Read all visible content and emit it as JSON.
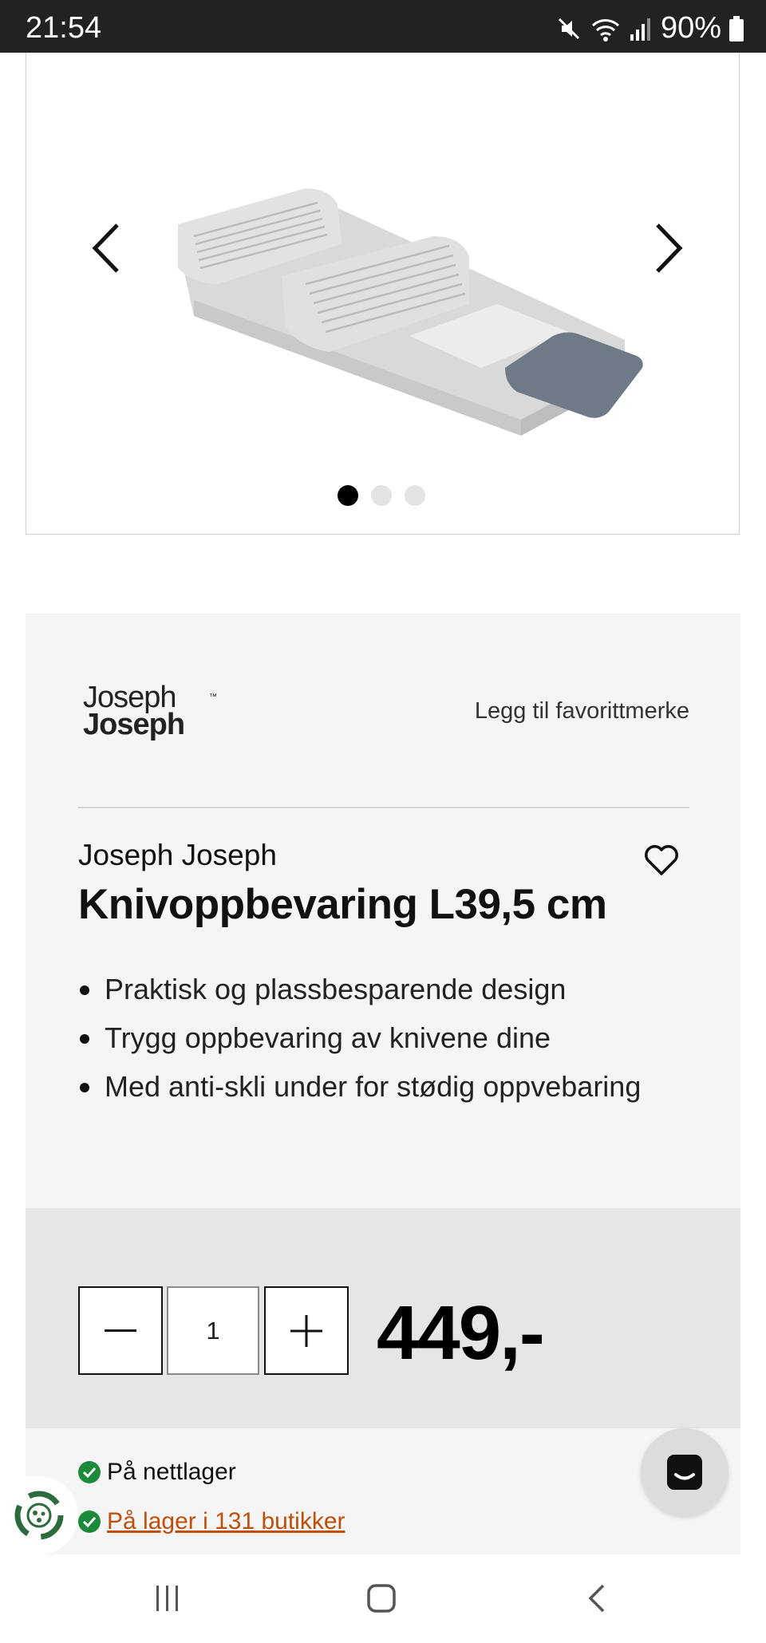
{
  "status_bar": {
    "time": "21:54",
    "battery": "90%",
    "icons": [
      "mute-icon",
      "wifi-icon",
      "signal-icon",
      "battery-icon"
    ]
  },
  "gallery": {
    "prev_icon": "chevron-left-icon",
    "next_icon": "chevron-right-icon",
    "image": "knife-organizer-image",
    "dots_total": 3,
    "active_dot": 1
  },
  "product": {
    "brand_logo": {
      "line1": "Joseph",
      "line2": "Joseph",
      "tm": "™"
    },
    "favorite_link": "Legg til favorittmerke",
    "brand": "Joseph Joseph",
    "title": "Knivoppbevaring L39,5 cm",
    "features": [
      "Praktisk og plassbesparende design",
      "Trygg oppbevaring av knivene dine",
      "Med anti-skli under for stødig oppvebaring"
    ]
  },
  "purchase": {
    "quantity": "1",
    "price": "449,-"
  },
  "stock": {
    "online": "På nettlager",
    "stores": "På lager i 131 butikker"
  },
  "colors": {
    "status_bar_bg": "#222222",
    "panel_bg": "#f5f5f5",
    "buybar_bg": "#e6e6e6",
    "check_green": "#1b8a3a",
    "stores_link": "#c14e0a"
  }
}
